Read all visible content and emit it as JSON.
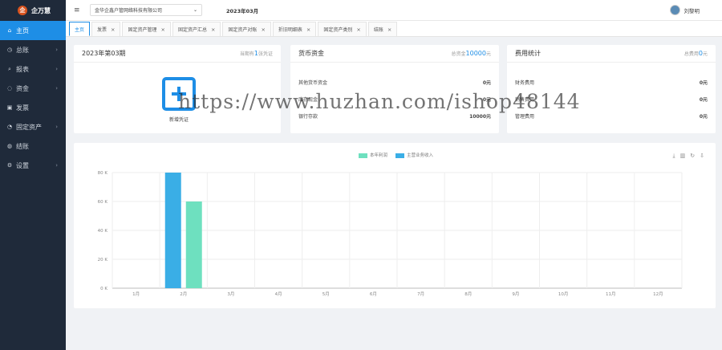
{
  "app": {
    "name": "企万慧"
  },
  "sidebar": {
    "items": [
      {
        "label": "主页",
        "icon": "home-icon",
        "glyph": "⌂",
        "active": true,
        "expandable": false
      },
      {
        "label": "总账",
        "icon": "ledger-icon",
        "glyph": "◷",
        "active": false,
        "expandable": true
      },
      {
        "label": "报表",
        "icon": "report-icon",
        "glyph": "⌕",
        "active": false,
        "expandable": true
      },
      {
        "label": "资金",
        "icon": "fund-icon",
        "glyph": "◌",
        "active": false,
        "expandable": true
      },
      {
        "label": "发票",
        "icon": "invoice-icon",
        "glyph": "▣",
        "active": false,
        "expandable": false
      },
      {
        "label": "固定资产",
        "icon": "asset-icon",
        "glyph": "◔",
        "active": false,
        "expandable": true
      },
      {
        "label": "结账",
        "icon": "checkout-icon",
        "glyph": "◍",
        "active": false,
        "expandable": false
      },
      {
        "label": "设置",
        "icon": "settings-icon",
        "glyph": "⚙",
        "active": false,
        "expandable": true
      }
    ]
  },
  "topbar": {
    "company": "金华企鑫户管网络科技有限公司",
    "period": "2023年03月",
    "user": "刘黎明"
  },
  "tabs": [
    {
      "label": "主页",
      "active": true,
      "closable": false
    },
    {
      "label": "发票",
      "active": false,
      "closable": true
    },
    {
      "label": "固定资产管理",
      "active": false,
      "closable": true
    },
    {
      "label": "固定资产汇总",
      "active": false,
      "closable": true
    },
    {
      "label": "固定资产对账",
      "active": false,
      "closable": true
    },
    {
      "label": "折旧明细表",
      "active": false,
      "closable": true
    },
    {
      "label": "固定资产类别",
      "active": false,
      "closable": true
    },
    {
      "label": "结账",
      "active": false,
      "closable": true
    }
  ],
  "period_card": {
    "title": "2023年第03期",
    "note_prefix": "当期有",
    "note_count": "1",
    "note_suffix": "张凭证",
    "action_label": "新增凭证"
  },
  "cash_card": {
    "title": "货币资金",
    "note_prefix": "总资金",
    "note_value": "10000",
    "note_suffix": "元",
    "rows": [
      {
        "label": "其他货币资金",
        "value": "0元"
      },
      {
        "label": "库存现金",
        "value": "0元"
      },
      {
        "label": "银行存款",
        "value": "10000元"
      }
    ]
  },
  "expense_card": {
    "title": "费用统计",
    "note_prefix": "总费用",
    "note_value": "0",
    "note_suffix": "元",
    "rows": [
      {
        "label": "财务费用",
        "value": "0元"
      },
      {
        "label": "销售费用",
        "value": "0元"
      },
      {
        "label": "管理费用",
        "value": "0元"
      }
    ]
  },
  "toolbox": [
    {
      "name": "download-icon",
      "glyph": "⤓"
    },
    {
      "name": "bar-chart-icon",
      "glyph": "▥"
    },
    {
      "name": "refresh-icon",
      "glyph": "↻"
    },
    {
      "name": "save-image-icon",
      "glyph": "⇩"
    }
  ],
  "colors": {
    "primary": "#1e8ee6",
    "sidebar": "#1f2a3a",
    "profit": "#6ee0bf",
    "revenue": "#3aaee6"
  },
  "chart_data": {
    "type": "bar",
    "categories": [
      "1月",
      "2月",
      "3月",
      "4月",
      "5月",
      "6月",
      "7月",
      "8月",
      "9月",
      "10月",
      "11月",
      "12月"
    ],
    "series": [
      {
        "name": "本年利润",
        "color": "#6ee0bf",
        "values": [
          0,
          60000,
          0,
          0,
          0,
          0,
          0,
          0,
          0,
          0,
          0,
          0
        ]
      },
      {
        "name": "主营业务收入",
        "color": "#3aaee6",
        "values": [
          0,
          80000,
          0,
          0,
          0,
          0,
          0,
          0,
          0,
          0,
          0,
          0
        ]
      }
    ],
    "ylim": [
      0,
      80000
    ],
    "yticks": [
      0,
      20000,
      40000,
      60000,
      80000
    ],
    "ytick_labels": [
      "0 K",
      "20 K",
      "40 K",
      "60 K",
      "80 K"
    ],
    "legend_position": "top-center",
    "grid": true
  },
  "watermark": "https://www.huzhan.com/ishop48144"
}
